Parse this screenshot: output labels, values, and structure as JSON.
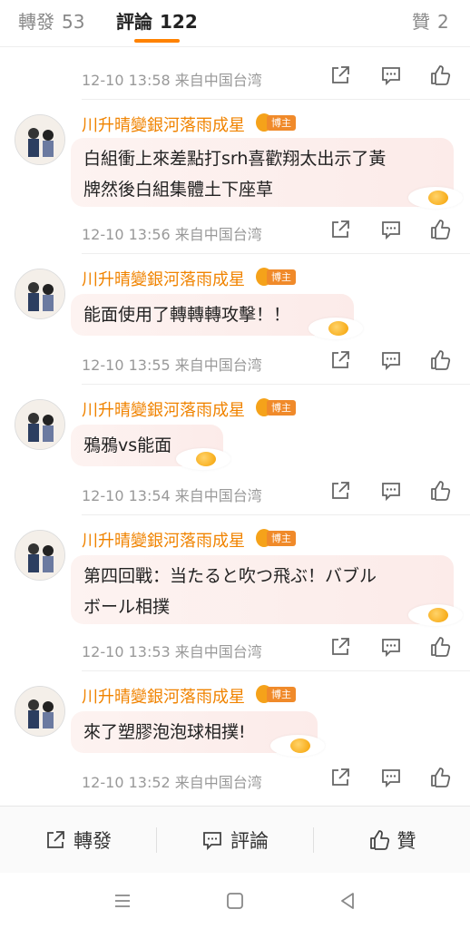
{
  "tabs": {
    "repost_label": "轉發",
    "repost_count": "53",
    "comment_label": "評論",
    "comment_count": "122",
    "like_label": "贊",
    "like_count": "2"
  },
  "first_meta": {
    "time": "12-10 13:58 来自中国台湾"
  },
  "badge_label": "博主",
  "comments": [
    {
      "user": "川升晴變銀河落雨成星",
      "text_lines": [
        "白組衝上來差點打srh喜歡翔太出示了黃",
        "牌然後白組集體土下座草"
      ],
      "time": "12-10 13:56 来自中国台湾"
    },
    {
      "user": "川升晴變銀河落雨成星",
      "text_lines": [
        "能面使用了轉轉轉攻擊！！"
      ],
      "time": "12-10 13:55 来自中国台湾"
    },
    {
      "user": "川升晴變銀河落雨成星",
      "text_lines": [
        "鴉鴉vs能面"
      ],
      "time": "12-10 13:54 来自中国台湾"
    },
    {
      "user": "川升晴變銀河落雨成星",
      "text_lines": [
        "第四回戰：当たると吹つ飛ぶ！バブル",
        "ボール相撲"
      ],
      "time": "12-10 13:53 来自中国台湾"
    },
    {
      "user": "川升晴變銀河落雨成星",
      "text_lines": [
        "來了塑膠泡泡球相撲!"
      ],
      "time": "12-10 13:52 来自中国台湾"
    }
  ],
  "bottom_bar": {
    "repost": "轉發",
    "comment": "評論",
    "like": "贊"
  },
  "colors": {
    "accent": "#ff8200",
    "username": "#f08300",
    "badge": "#f08a2a",
    "meta": "#999999"
  },
  "icons": [
    "share-icon",
    "reply-icon",
    "thumbs-up-icon",
    "egg-sticker-icon",
    "menu-icon",
    "home-icon",
    "back-icon"
  ]
}
